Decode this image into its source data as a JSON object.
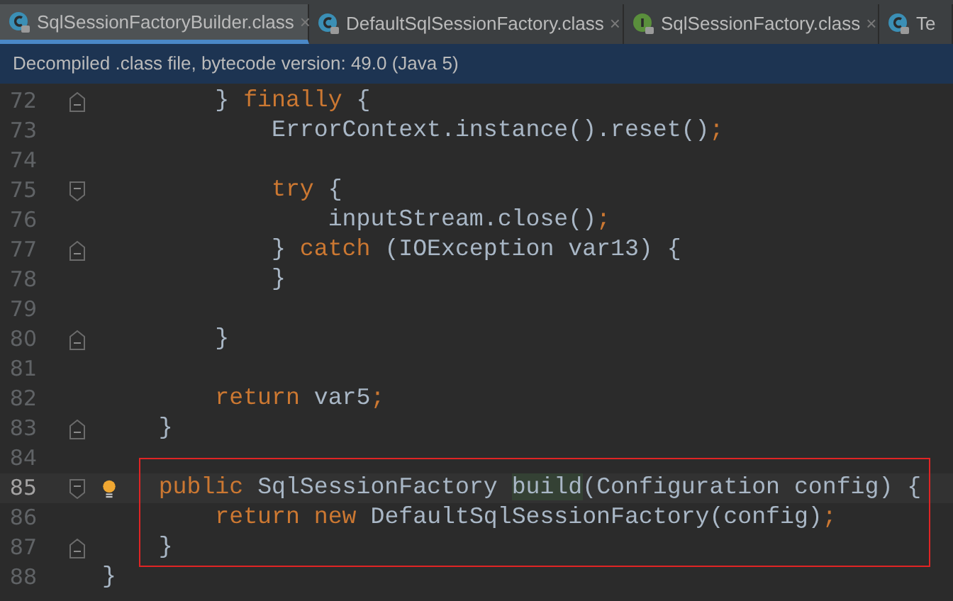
{
  "tabs": [
    {
      "label": "SqlSessionFactoryBuilder.class",
      "kind": "class",
      "close": "×",
      "selected": true
    },
    {
      "label": "DefaultSqlSessionFactory.class",
      "kind": "class",
      "close": "×",
      "selected": false
    },
    {
      "label": "SqlSessionFactory.class",
      "kind": "interface",
      "close": "×",
      "selected": false
    },
    {
      "label": "Te",
      "kind": "class",
      "selected": false
    }
  ],
  "info_bar": "Decompiled .class file, bytecode version: 49.0 (Java 5)",
  "editor": {
    "lines": [
      {
        "number": "72",
        "kind": "fold_end",
        "current": false,
        "tokens": [
          {
            "text": "        } ",
            "kind": "plain"
          },
          {
            "text": "finally",
            "kind": "keyword"
          },
          {
            "text": " {",
            "kind": "plain"
          }
        ]
      },
      {
        "number": "73",
        "kind": "plain",
        "current": false,
        "tokens": [
          {
            "text": "            ErrorContext.instance().reset()",
            "kind": "plain"
          },
          {
            "text": ";",
            "kind": "keyword"
          }
        ]
      },
      {
        "number": "74",
        "kind": "plain",
        "current": false
      },
      {
        "number": "75",
        "kind": "fold_start",
        "current": false,
        "tokens": [
          {
            "text": "            try",
            "kind": "keyword"
          },
          {
            "text": " {",
            "kind": "plain"
          }
        ]
      },
      {
        "number": "76",
        "kind": "plain",
        "current": false,
        "tokens": [
          {
            "text": "                inputStream.close()",
            "kind": "plain"
          },
          {
            "text": ";",
            "kind": "keyword"
          }
        ]
      },
      {
        "number": "77",
        "kind": "fold_end",
        "current": false,
        "tokens": [
          {
            "text": "            } ",
            "kind": "plain"
          },
          {
            "text": "catch",
            "kind": "keyword"
          },
          {
            "text": " (IOException var13) {",
            "kind": "plain"
          }
        ]
      },
      {
        "number": "78",
        "kind": "plain",
        "current": false,
        "tokens": [
          {
            "text": "            }",
            "kind": "plain"
          }
        ]
      },
      {
        "number": "79",
        "kind": "plain",
        "current": false
      },
      {
        "number": "80",
        "kind": "fold_end",
        "current": false,
        "tokens": [
          {
            "text": "        }",
            "kind": "plain"
          }
        ]
      },
      {
        "number": "81",
        "kind": "plain",
        "current": false
      },
      {
        "number": "82",
        "kind": "plain",
        "current": false,
        "tokens": [
          {
            "text": "        return",
            "kind": "keyword"
          },
          {
            "text": " var5",
            "kind": "plain"
          },
          {
            "text": ";",
            "kind": "keyword"
          }
        ]
      },
      {
        "number": "83",
        "kind": "fold_end",
        "current": false,
        "tokens": [
          {
            "text": "    }",
            "kind": "plain"
          }
        ]
      },
      {
        "number": "84",
        "kind": "plain",
        "current": false
      },
      {
        "number": "85",
        "kind": "fold_start",
        "current": true,
        "bulb": true,
        "boxed": true,
        "tokens": [
          {
            "text": "    public",
            "kind": "keyword"
          },
          {
            "text": " SqlSessionFactory ",
            "kind": "plain"
          },
          {
            "text": "build",
            "kind": "usage"
          },
          {
            "text": "(Configuration config) {",
            "kind": "plain"
          }
        ]
      },
      {
        "number": "86",
        "kind": "plain",
        "current": false,
        "boxed": true,
        "tokens": [
          {
            "text": "        return new",
            "kind": "keyword"
          },
          {
            "text": " DefaultSqlSessionFactory(config)",
            "kind": "plain"
          },
          {
            "text": ";",
            "kind": "keyword"
          }
        ]
      },
      {
        "number": "87",
        "kind": "fold_end",
        "current": false,
        "boxed": true,
        "tokens": [
          {
            "text": "    }",
            "kind": "plain"
          }
        ]
      },
      {
        "number": "88",
        "kind": "plain",
        "current": false,
        "tokens": [
          {
            "text": "}",
            "kind": "plain"
          }
        ]
      }
    ]
  }
}
